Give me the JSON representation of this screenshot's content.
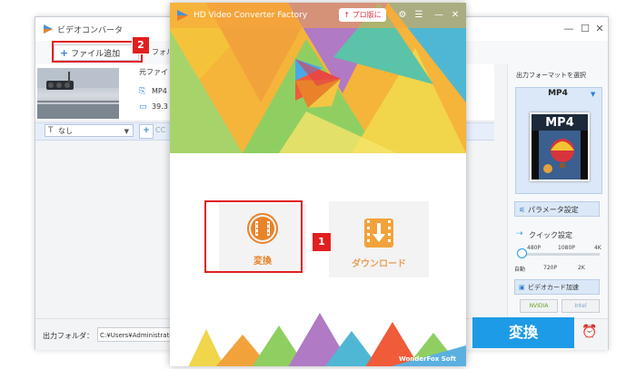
{
  "background_window": {
    "title": "ビデオコンバータ",
    "controls": {
      "minimize": "—",
      "maximize": "☐",
      "close": "✕"
    },
    "toolbar": {
      "add_file_label": "ファイル追加",
      "folder_label_partial": "フォル"
    },
    "file": {
      "source_label_partial": "元ファイ",
      "format": "MP4",
      "size_partial": "39.3"
    },
    "subtitle": {
      "value": "なし",
      "cc": "CC"
    },
    "output_folder": {
      "label": "出力フォルダ：",
      "path": "C:¥Users¥Administrator¥Vide"
    },
    "convert_button": "変換",
    "right_panel": {
      "output_format_title": "出力フォーマットを選択",
      "format_name": "MP4",
      "format_icon_text": "MP4",
      "params_button": "パラメータ設定",
      "quick_settings": "クイック設定",
      "quality_top_ticks": [
        "480P",
        "1080P",
        "4K"
      ],
      "quality_bottom_ticks": [
        "自動",
        "720P",
        "2K"
      ],
      "quality_level": 0,
      "gpu_button": "ビデオカード加速",
      "gpu_chips": [
        "NVIDIA",
        "Intel"
      ]
    }
  },
  "launcher": {
    "title": "HD Video Converter Factory",
    "pro_button": "プロ版に",
    "convert_label": "変換",
    "download_label": "ダウンロード",
    "brand": "WonderFox Soft"
  },
  "annotations": {
    "step1": "1",
    "step2": "2"
  },
  "colors": {
    "accent_blue": "#1e9be6",
    "highlight_red": "#e02020",
    "card_orange": "#e8832a"
  }
}
